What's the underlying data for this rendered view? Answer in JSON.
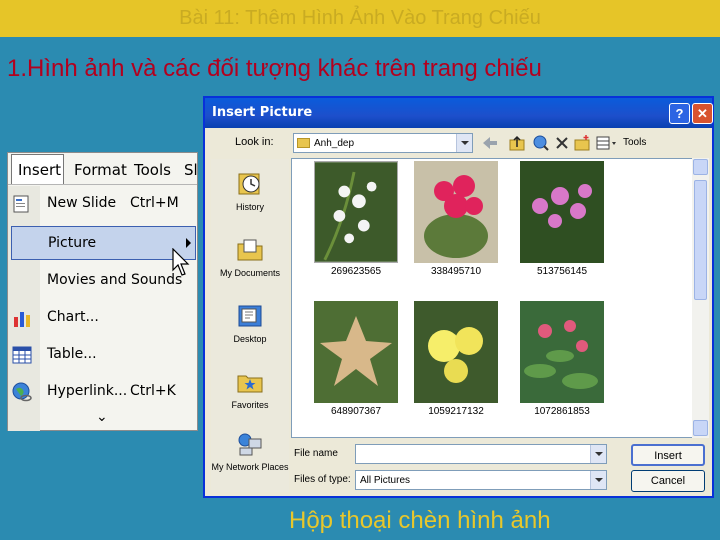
{
  "slide": {
    "banner": "Bài 11: Thêm Hình Ảnh Vào Trang Chiếu",
    "heading": "1.Hình ảnh và các đối tượng khác trên trang chiếu",
    "caption": "Hộp thoại chèn hình ảnh"
  },
  "menu": {
    "bar": [
      "Insert",
      "Format",
      "Tools",
      "Sl"
    ],
    "items": [
      {
        "label": "New Slide",
        "shortcut": "Ctrl+M"
      },
      {
        "label": "Picture",
        "shortcut": ""
      },
      {
        "label": "Movies and Sounds",
        "shortcut": ""
      },
      {
        "label": "Chart...",
        "shortcut": ""
      },
      {
        "label": "Table...",
        "shortcut": ""
      },
      {
        "label": "Hyperlink...",
        "shortcut": "Ctrl+K"
      }
    ],
    "more": "⌄"
  },
  "dialog": {
    "title": "Insert Picture",
    "help": "?",
    "close": "✕",
    "lookin_label": "Look in:",
    "lookin_value": "Anh_dep",
    "tools_label": "Tools",
    "places": [
      "History",
      "My Documents",
      "Desktop",
      "Favorites",
      "My Network Places"
    ],
    "files": [
      "269623565",
      "338495710",
      "513756145",
      "648907367",
      "1059217132",
      "1072861853"
    ],
    "filename_label": "File name",
    "filename_value": "",
    "filetype_label": "Files of type:",
    "filetype_value": "All Pictures",
    "insert_button": "Insert",
    "cancel_button": "Cancel"
  },
  "colors": {
    "background": "#2b8bb1",
    "banner": "#e6c528",
    "heading": "#b3001e",
    "caption": "#e8c72b",
    "titlebar": "#0a5cdb"
  }
}
